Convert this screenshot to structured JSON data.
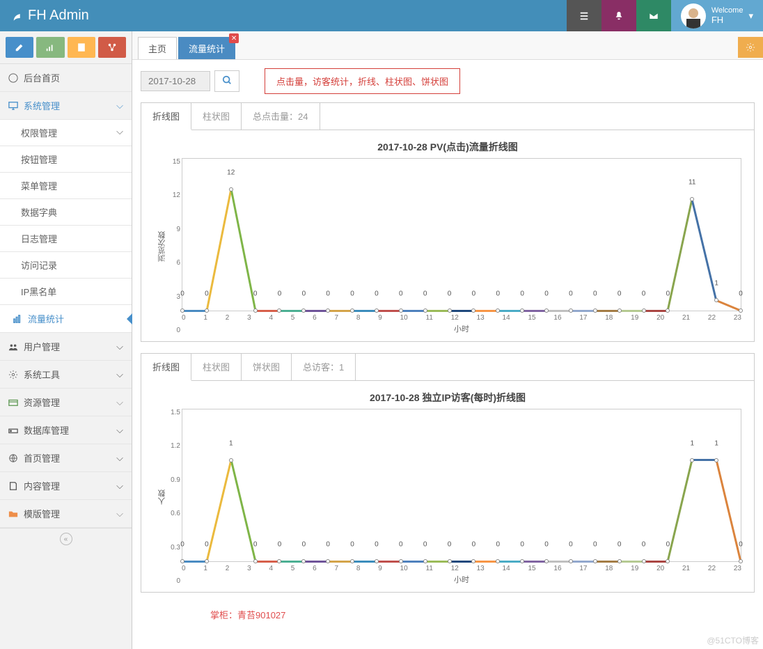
{
  "header": {
    "brand": "FH Admin",
    "welcome": "Welcome",
    "user": "FH"
  },
  "btns": {
    "pencil": "pencil",
    "signal": "signal",
    "book": "book",
    "share": "share"
  },
  "menu": {
    "dash": "后台首页",
    "sys": "系统管理",
    "subs": [
      "权限管理",
      "按钮管理",
      "菜单管理",
      "数据字典",
      "日志管理",
      "访问记录",
      "IP黑名单",
      "流量统计"
    ],
    "user": "用户管理",
    "tools": "系统工具",
    "res": "资源管理",
    "db": "数据库管理",
    "home": "首页管理",
    "cont": "内容管理",
    "tpl": "模版管理"
  },
  "tabs": {
    "home": "主页",
    "flow": "流量统计"
  },
  "content": {
    "date": "2017-10-28",
    "redbox": "点击量，访客统计，折线、柱状图、饼状图",
    "ptab_line": "折线图",
    "ptab_bar": "柱状图",
    "ptab_pie": "饼状图",
    "total_click": "总点击量：24",
    "total_visit": "总访客：1",
    "xaxis": "小时"
  },
  "footer": "掌柜：青苔901027",
  "watermark": "@51CTO博客",
  "chart_data": [
    {
      "type": "line",
      "title": "2017-10-28  PV(点击)流量折线图",
      "xlabel": "小时",
      "ylabel": "浏览次数",
      "ylim": [
        0,
        15
      ],
      "categories": [
        "0",
        "1",
        "2",
        "3",
        "4",
        "5",
        "6",
        "7",
        "8",
        "9",
        "10",
        "11",
        "12",
        "13",
        "14",
        "15",
        "16",
        "17",
        "18",
        "19",
        "20",
        "21",
        "22",
        "23"
      ],
      "values": [
        0,
        0,
        12,
        0,
        0,
        0,
        0,
        0,
        0,
        0,
        0,
        0,
        0,
        0,
        0,
        0,
        0,
        0,
        0,
        0,
        0,
        11,
        1,
        0
      ]
    },
    {
      "type": "line",
      "title": "2017-10-28  独立IP访客(每时)折线图",
      "xlabel": "小时",
      "ylabel": "人数",
      "ylim": [
        0,
        1.5
      ],
      "categories": [
        "0",
        "1",
        "2",
        "3",
        "4",
        "5",
        "6",
        "7",
        "8",
        "9",
        "10",
        "11",
        "12",
        "13",
        "14",
        "15",
        "16",
        "17",
        "18",
        "19",
        "20",
        "21",
        "22",
        "23"
      ],
      "values": [
        0,
        0,
        1,
        0,
        0,
        0,
        0,
        0,
        0,
        0,
        0,
        0,
        0,
        0,
        0,
        0,
        0,
        0,
        0,
        0,
        0,
        1,
        1,
        0
      ]
    }
  ],
  "colors": [
    "#4A8BC2",
    "#EBBA3E",
    "#7FB548",
    "#D7604B",
    "#4CAF93",
    "#6F5499",
    "#D4A44A",
    "#3C8DBC",
    "#C0504D",
    "#4F81BD",
    "#9BBB59",
    "#1F497D",
    "#F79646",
    "#4BACC6",
    "#8064A2",
    "#C0C0C0",
    "#92A8CD",
    "#A47D46",
    "#B5CA92",
    "#AA4643",
    "#89A54E",
    "#4572A7",
    "#DB843D",
    "#80699B"
  ]
}
